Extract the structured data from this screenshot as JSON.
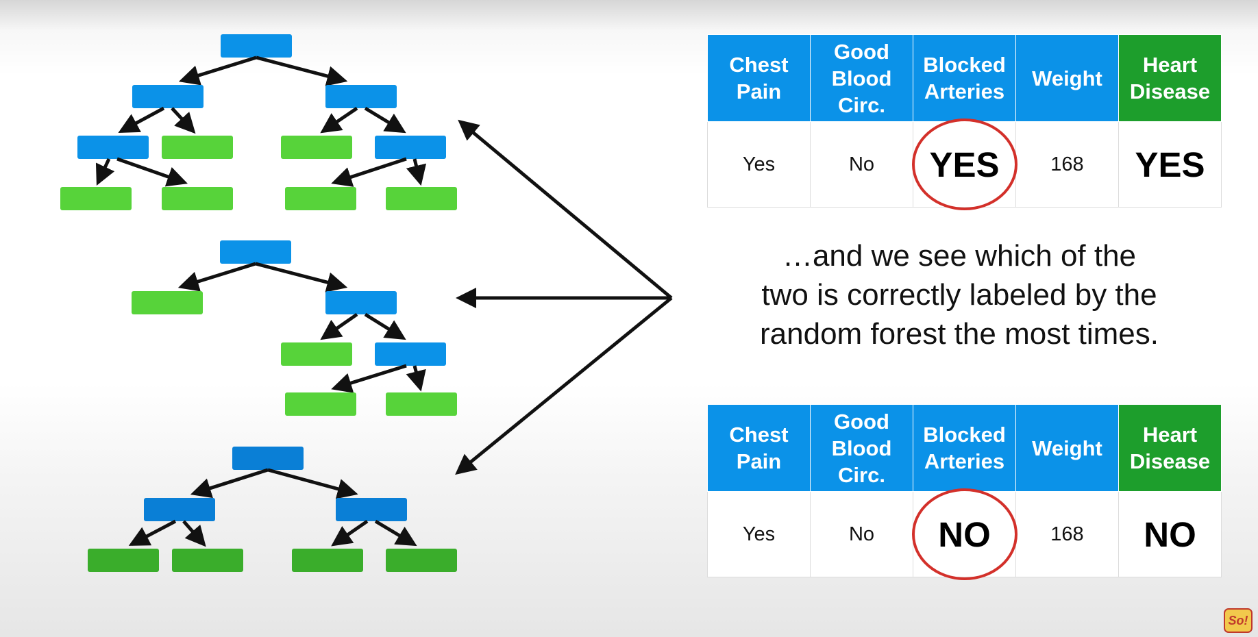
{
  "headers": [
    "Chest Pain",
    "Good Blood Circ.",
    "Blocked Arteries",
    "Weight",
    "Heart Disease"
  ],
  "header_lines": [
    [
      "Chest",
      "Pain"
    ],
    [
      "Good",
      "Blood",
      "Circ."
    ],
    [
      "Blocked",
      "Arteries"
    ],
    [
      "Weight"
    ],
    [
      "Heart",
      "Disease"
    ]
  ],
  "top_row": {
    "chest_pain": "Yes",
    "good_blood_circ": "No",
    "blocked_arteries": "YES",
    "weight": "168",
    "heart_disease": "YES"
  },
  "bottom_row": {
    "chest_pain": "Yes",
    "good_blood_circ": "No",
    "blocked_arteries": "NO",
    "weight": "168",
    "heart_disease": "NO"
  },
  "caption_lines": [
    "…and we see which of the",
    "two is correctly labeled by the",
    "random forest the most times."
  ],
  "logo_text": "So!",
  "colors": {
    "decision_node": "#0b92e8",
    "decision_node_dark": "#0a7fd6",
    "leaf_node": "#57d33a",
    "leaf_node_dark": "#3aad2b",
    "target_header": "#1d9e2c",
    "highlight_circle": "#d3302a"
  }
}
